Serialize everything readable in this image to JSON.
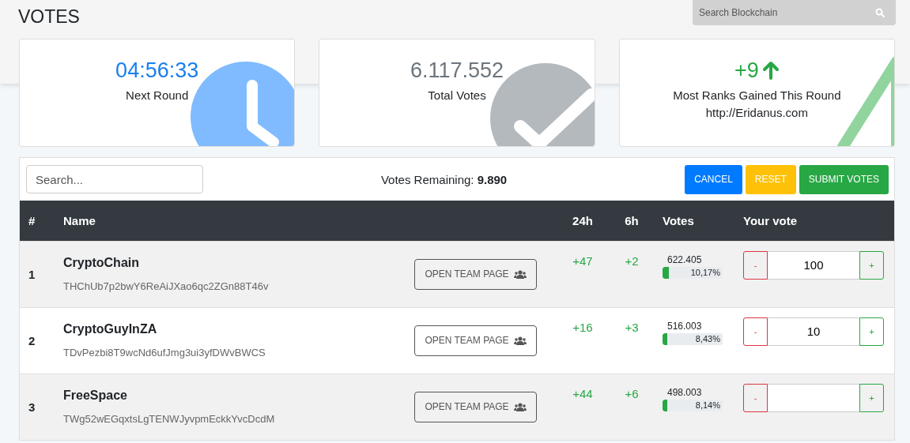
{
  "page_title": "VOTES",
  "search": {
    "placeholder": "Search Blockchain"
  },
  "cards": [
    {
      "kind": "clock",
      "value": "04:56:33",
      "label": "Next Round"
    },
    {
      "kind": "check",
      "value": "6.117.552",
      "label": "Total Votes"
    },
    {
      "kind": "rank",
      "value": "+9",
      "label": "Most Ranks Gained This Round",
      "link": "http://Eridanus.com"
    }
  ],
  "toolbar": {
    "search_placeholder": "Search...",
    "remaining_label": "Votes Remaining:",
    "remaining_value": "9.890",
    "buttons": [
      {
        "kind": "cancel",
        "label": "CANCEL"
      },
      {
        "kind": "reset",
        "label": "RESET"
      },
      {
        "kind": "submit",
        "label": "SUBMIT VOTES"
      }
    ]
  },
  "table": {
    "columns": [
      "#",
      "Name",
      "24h",
      "6h",
      "Votes",
      "Your vote"
    ],
    "rows": [
      {
        "rank": "1",
        "name": "CryptoChain",
        "address": "THChUb7p2bwY6ReAiJXao6qc2ZGn88T46v",
        "button": "OPEN TEAM PAGE",
        "d24": "+47",
        "d6": "+2",
        "votes": "622.405",
        "share": "10,17%",
        "level": 0.1017,
        "minus": "-",
        "vote": "100",
        "plus": "+"
      },
      {
        "rank": "2",
        "name": "CryptoGuyInZA",
        "address": "TDvPezbi8T9wcNd6ufJmg3ui3yfDWvBWCS",
        "button": "OPEN TEAM PAGE",
        "d24": "+16",
        "d6": "+3",
        "votes": "516.003",
        "share": "8,43%",
        "level": 0.0843,
        "minus": "-",
        "vote": "10",
        "plus": "+"
      },
      {
        "rank": "3",
        "name": "FreeSpace",
        "address": "TWg52wEGqxtsLgTENWJyvpmEckkYvcDcdM",
        "button": "OPEN TEAM PAGE",
        "d24": "+44",
        "d6": "+6",
        "votes": "498.003",
        "share": "8,14%",
        "level": 0.0814,
        "minus": "-",
        "plus": "+"
      }
    ]
  }
}
